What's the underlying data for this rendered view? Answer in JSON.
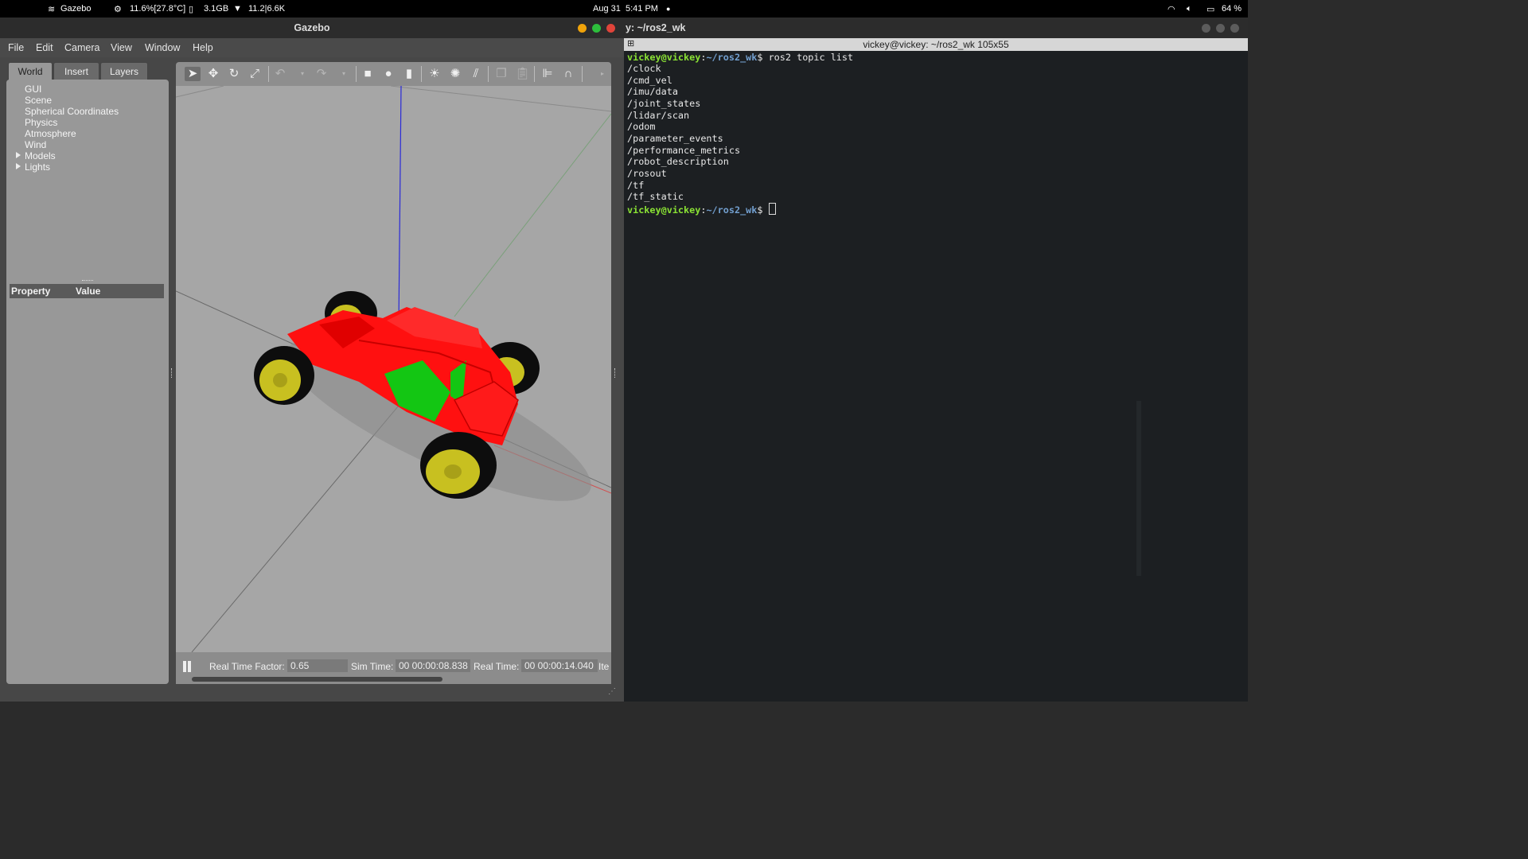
{
  "topbar": {
    "app_name": "Gazebo",
    "cpu": "11.6%[27.8°C]",
    "mem": "3.1GB",
    "net": "11.2|6.6K",
    "date": "Aug 31",
    "time": "5:41 PM",
    "battery": "64 %"
  },
  "gazebo": {
    "window_title": "Gazebo",
    "menu": [
      "File",
      "Edit",
      "Camera",
      "View",
      "Window",
      "Help"
    ],
    "tabs": [
      "World",
      "Insert",
      "Layers"
    ],
    "tree": [
      "GUI",
      "Scene",
      "Spherical Coordinates",
      "Physics",
      "Atmosphere",
      "Wind",
      "Models",
      "Lights"
    ],
    "prop_header": {
      "property": "Property",
      "value": "Value"
    },
    "status": {
      "rtf_label": "Real Time Factor:",
      "rtf_value": "0.65",
      "sim_label": "Sim Time:",
      "sim_value": "00 00:00:08.838",
      "real_label": "Real Time:",
      "real_value": "00 00:00:14.040",
      "more": "Ite"
    }
  },
  "terminal": {
    "window_title": "y: ~/ros2_wk",
    "subtitle": "vickey@vickey: ~/ros2_wk 105x55",
    "prompt_user": "vickey@vickey",
    "prompt_path": "~/ros2_wk",
    "command": "$ ros2 topic list",
    "prompt_end": "$ ",
    "topics": [
      "/clock",
      "/cmd_vel",
      "/imu/data",
      "/joint_states",
      "/lidar/scan",
      "/odom",
      "/parameter_events",
      "/performance_metrics",
      "/robot_description",
      "/rosout",
      "/tf",
      "/tf_static"
    ]
  },
  "colors": {
    "chassis": "#ff1010",
    "glass": "#13c613",
    "wheel_hub": "#c8c020",
    "tyre": "#0d0d0d"
  }
}
